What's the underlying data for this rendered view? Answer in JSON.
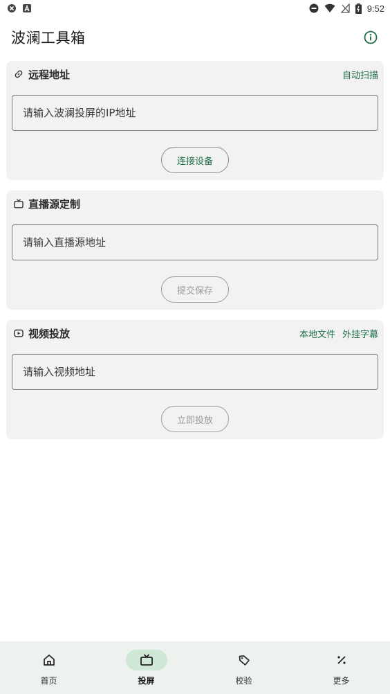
{
  "status_bar": {
    "time": "9:52",
    "left_icons": [
      "shield-icon",
      "a-icon"
    ],
    "right_icons": [
      "do-not-disturb-icon",
      "wifi-icon",
      "no-signal-icon",
      "battery-icon"
    ]
  },
  "app": {
    "title": "波澜工具箱",
    "info_icon": "info-icon",
    "accent_color": "#1f6f49"
  },
  "remote": {
    "title": "远程地址",
    "icon": "link-icon",
    "action": "自动扫描",
    "input_placeholder": "请输入波澜投屏的IP地址",
    "button": "连接设备"
  },
  "live": {
    "title": "直播源定制",
    "icon": "tv-icon",
    "input_placeholder": "请输入直播源地址",
    "button": "提交保存"
  },
  "video": {
    "title": "视频投放",
    "icon": "play-icon",
    "actions": [
      "本地文件",
      "外挂字幕"
    ],
    "input_placeholder": "请输入视频地址",
    "button": "立即投放"
  },
  "nav": {
    "items": [
      {
        "label": "首页",
        "icon": "home-icon",
        "active": false
      },
      {
        "label": "投屏",
        "icon": "tv-icon",
        "active": true
      },
      {
        "label": "校验",
        "icon": "tag-icon",
        "active": false
      },
      {
        "label": "更多",
        "icon": "percent-icon",
        "active": false
      }
    ]
  }
}
